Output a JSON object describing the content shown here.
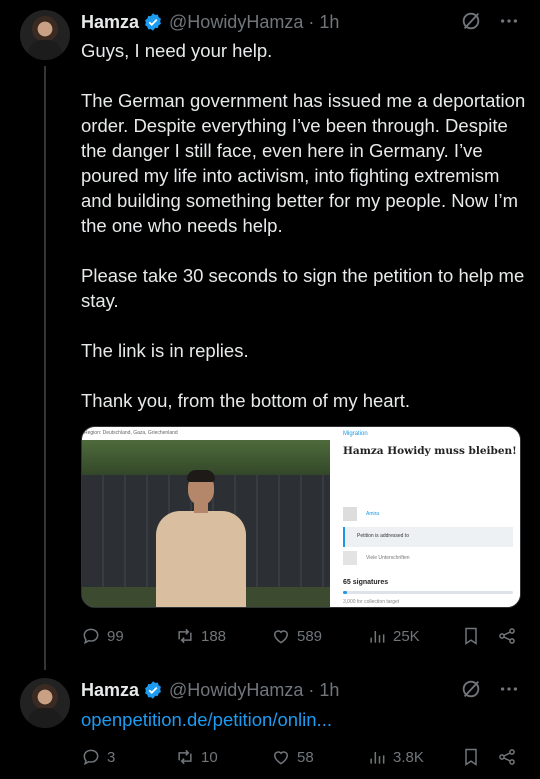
{
  "tweets": [
    {
      "author": {
        "name": "Hamza",
        "handle": "@HowidyHamza",
        "time": "1h"
      },
      "paragraphs": [
        "Guys, I need your help.",
        "The German government has issued me a deportation order. Despite everything I’ve been through. Despite the danger I still face, even here in Germany. I’ve poured my life into activism, into fighting extremism and building something better for my people. Now I’m the one who needs help.",
        "Please take 30 seconds to sign the petition to help me stay.",
        "The link is in replies.",
        "Thank you, from the bottom of my heart."
      ],
      "card": {
        "photo_caption": "Region: Deutschland, Gaza, Griechenland",
        "category": "Migration",
        "title": "Hamza Howidy muss bleiben!",
        "author_label": "Amira",
        "addressed_label": "Petition is addressed to",
        "supporters_label": "Viele Unterschriften",
        "signatures": "65 signatures",
        "target": "3,000 for collection target",
        "progress_fraction": 0.022
      },
      "actions": {
        "replies": "99",
        "reposts": "188",
        "likes": "589",
        "views": "25K"
      }
    },
    {
      "author": {
        "name": "Hamza",
        "handle": "@HowidyHamza",
        "time": "1h"
      },
      "link": "openpetition.de/petition/onlin...",
      "actions": {
        "replies": "3",
        "reposts": "10",
        "likes": "58",
        "views": "3.8K"
      }
    }
  ],
  "colors": {
    "background": "#000000",
    "text": "#e7e9ea",
    "muted": "#71767b",
    "link": "#1d9bf0",
    "verified": "#1d9bf0"
  },
  "icons": [
    "verified-badge-icon",
    "grok-icon",
    "more-icon",
    "reply-icon",
    "repost-icon",
    "like-icon",
    "views-icon",
    "bookmark-icon",
    "share-icon"
  ]
}
